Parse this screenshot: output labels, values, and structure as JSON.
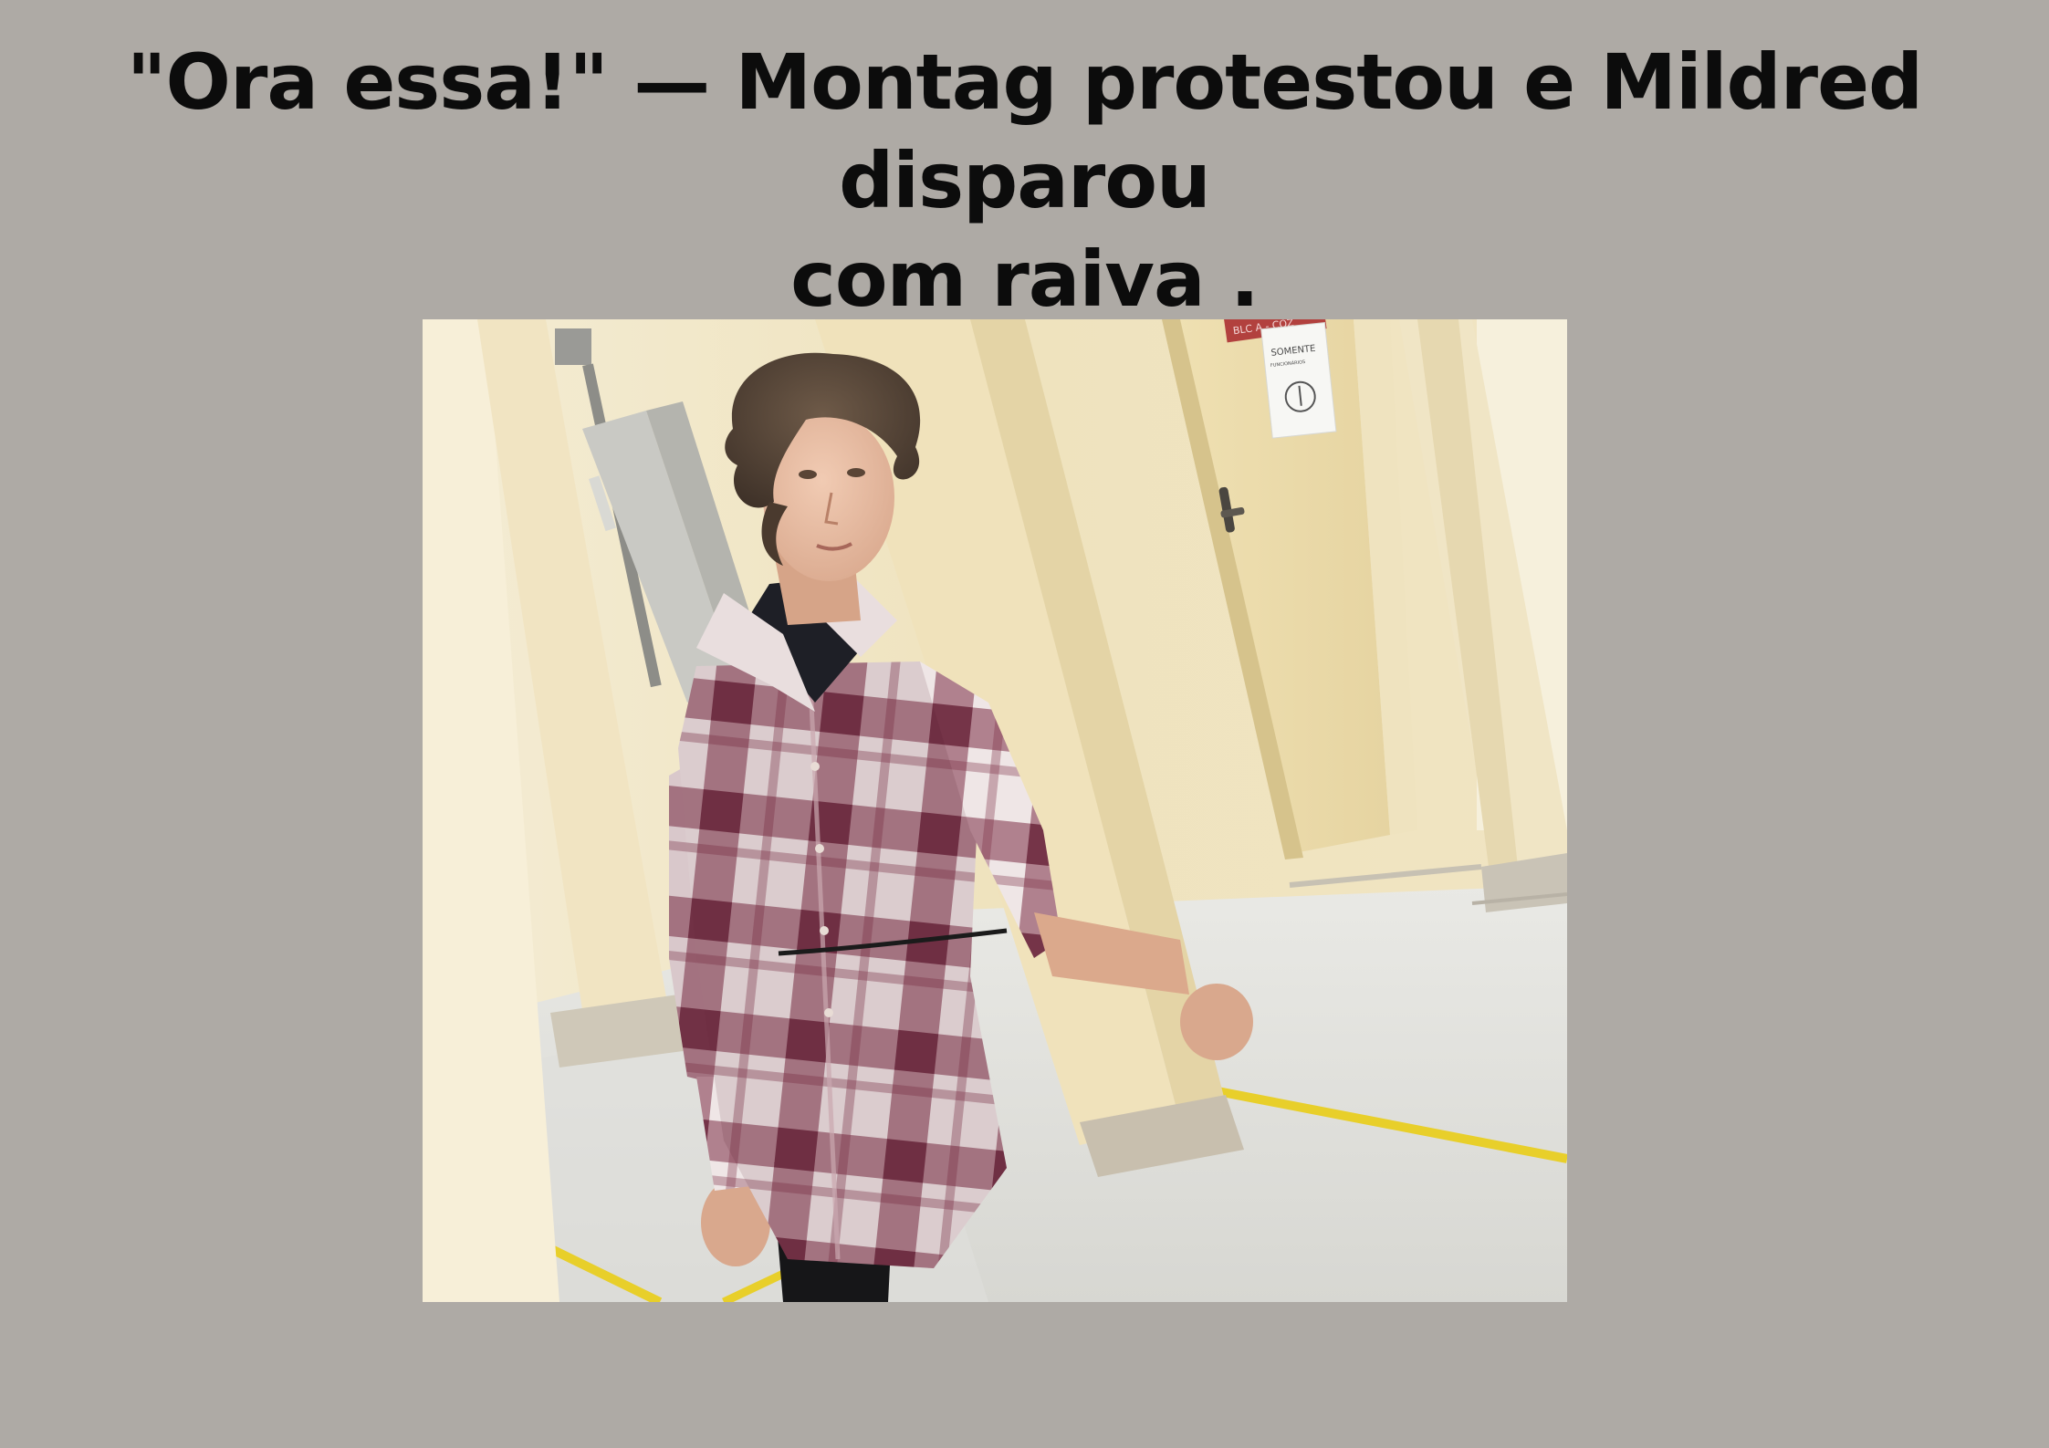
{
  "slide": {
    "caption_line1": "\"Ora essa!\" — Montag protestou e Mildred disparou",
    "caption_line2": "com raiva .",
    "background_color": "#aeaaa5",
    "text_color": "#0c0c0c"
  },
  "photo": {
    "door_band_text": "BLC A - COZ",
    "door_sign_title": "SOMENTE",
    "door_sign_subtitle": "FUNCIONÁRIOS"
  }
}
